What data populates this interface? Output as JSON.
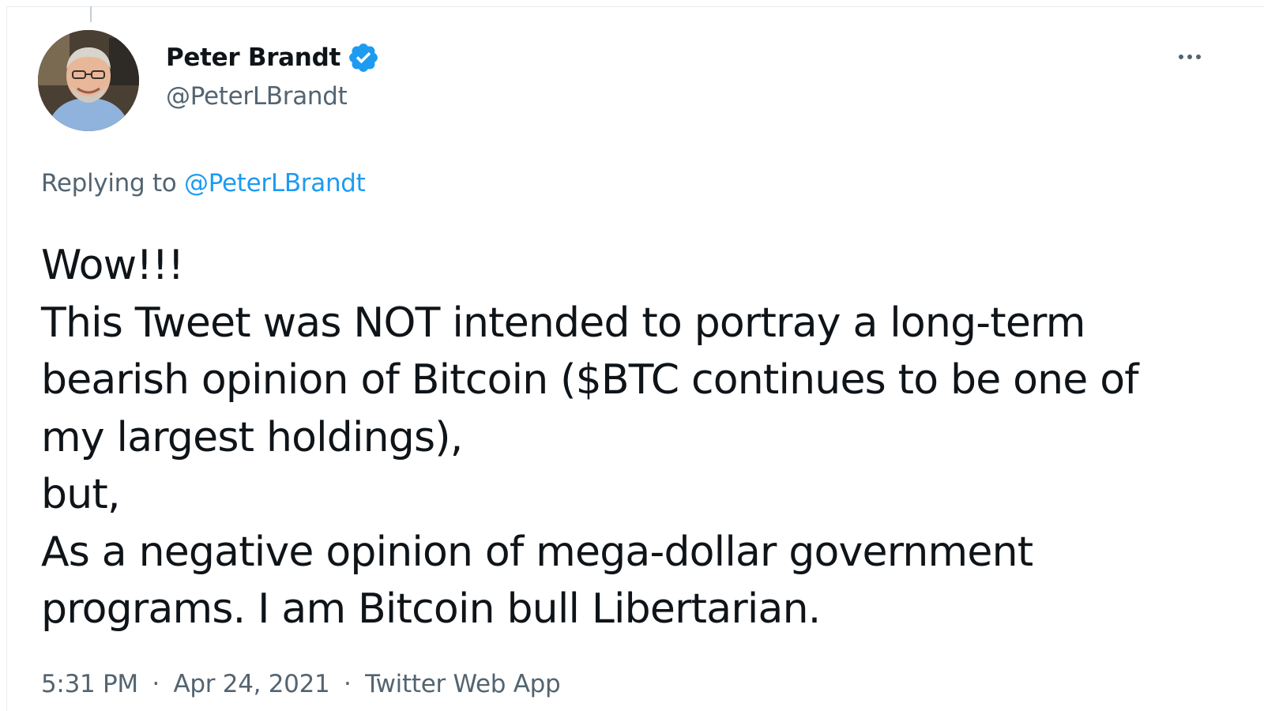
{
  "author": {
    "display_name": "Peter Brandt",
    "handle": "@PeterLBrandt",
    "verified": true,
    "verified_color": "#1d9bf0"
  },
  "reply": {
    "prefix": "Replying to",
    "handle": "@PeterLBrandt"
  },
  "tweet": {
    "lines": [
      "Wow!!!",
      "This Tweet was NOT intended to portray a long-term",
      "bearish opinion of Bitcoin ($BTC continues to be one of",
      "my largest holdings),",
      "but,",
      "As a negative opinion of mega-dollar government",
      "programs. I am Bitcoin bull Libertarian."
    ]
  },
  "meta": {
    "time": "5:31 PM",
    "date": "Apr 24, 2021",
    "source": "Twitter Web App",
    "separator": "·"
  },
  "icons": {
    "more": "more-options-icon",
    "verified": "verified-badge-icon"
  },
  "colors": {
    "text": "#0f1419",
    "secondary": "#536471",
    "link": "#1d9bf0"
  }
}
